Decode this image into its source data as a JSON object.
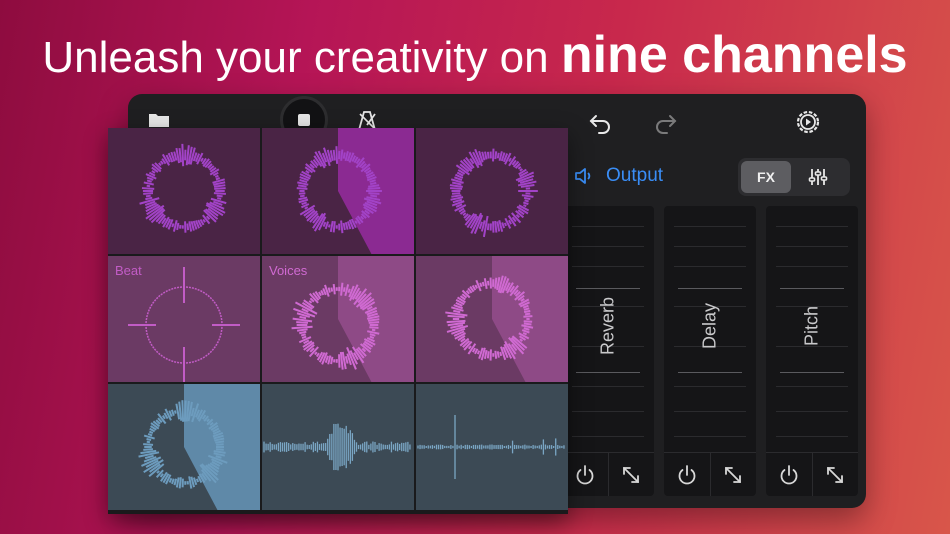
{
  "headline": {
    "lead": "Unleash your creativity on ",
    "bold": "nine channels"
  },
  "toolbar": {
    "icons": [
      "folder-icon",
      "stop-icon",
      "metronome-icon",
      "undo-icon",
      "redo-icon",
      "settings-icon"
    ]
  },
  "output": {
    "label": "Output",
    "fx_label": "FX"
  },
  "effects": [
    {
      "name": "Reverb"
    },
    {
      "name": "Delay"
    },
    {
      "name": "Pitch"
    }
  ],
  "pads": [
    {
      "label": "",
      "bg": "#4a2445",
      "wave": "#a243c7",
      "overlay": "",
      "style": "ring"
    },
    {
      "label": "",
      "bg": "#4a2445",
      "wave": "#a243c7",
      "overlay": "#8b2a92",
      "style": "ring"
    },
    {
      "label": "",
      "bg": "#4a2445",
      "wave": "#a243c7",
      "overlay": "",
      "style": "ring"
    },
    {
      "label": "Beat",
      "bg": "#6b3a64",
      "wave": "#c25cc6",
      "overlay": "",
      "style": "crosshair"
    },
    {
      "label": "Voices",
      "bg": "#6b3a64",
      "wave": "#d06ad2",
      "overlay": "#8e4a86",
      "style": "ring"
    },
    {
      "label": "",
      "bg": "#6b3a64",
      "wave": "#d06ad2",
      "overlay": "#8e4a86",
      "style": "ring"
    },
    {
      "label": "",
      "bg": "#3c4a55",
      "wave": "#6d9cbe",
      "overlay": "#5f89a8",
      "style": "ring"
    },
    {
      "label": "",
      "bg": "#3c4a55",
      "wave": "#7aa6c4",
      "overlay": "",
      "style": "linewave"
    },
    {
      "label": "",
      "bg": "#3c4a55",
      "wave": "#7aa6c4",
      "overlay": "",
      "style": "spikes"
    }
  ],
  "colors": {
    "accent": "#3a8df5",
    "device": "#1f1f21"
  }
}
